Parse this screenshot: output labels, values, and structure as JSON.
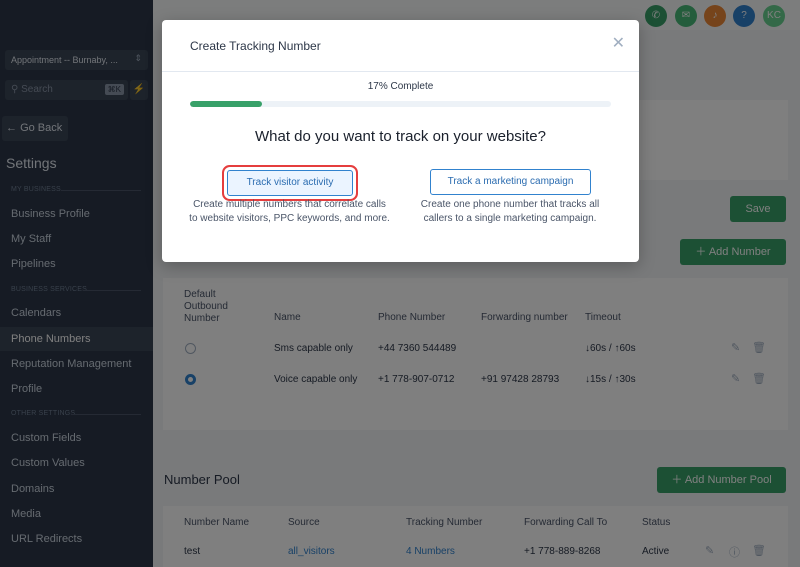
{
  "sidebar": {
    "location": "Appointment -- Burnaby, ...",
    "search_placeholder": "Search",
    "search_shortcut": "⌘K",
    "go_back": "Go Back",
    "title": "Settings",
    "sections": {
      "my_business": "MY BUSINESS",
      "business_services": "BUSINESS SERVICES",
      "other_settings": "OTHER SETTINGS"
    },
    "items": {
      "business_profile": "Business Profile",
      "my_staff": "My Staff",
      "pipelines": "Pipelines",
      "calendars": "Calendars",
      "phone_numbers": "Phone Numbers",
      "reputation_management": "Reputation Management",
      "profile": "Profile",
      "custom_fields": "Custom Fields",
      "custom_values": "Custom Values",
      "domains": "Domains",
      "media": "Media",
      "url_redirects": "URL Redirects"
    }
  },
  "topbar": {
    "avatar_initials": "KC",
    "colors": {
      "phone": "#38a169",
      "megaphone": "#48bb78",
      "bell": "#ed8936",
      "help": "#3182ce",
      "avatar": "#68d391"
    }
  },
  "main": {
    "save_label": "Save",
    "add_number_label": "Add Number",
    "numbers_table": {
      "headers": [
        "Default Outbound Number",
        "Name",
        "Phone Number",
        "Forwarding number",
        "Timeout"
      ],
      "rows": [
        {
          "default": false,
          "name": "Sms capable only",
          "phone": "+44 7360 544489",
          "forwarding": "",
          "timeout_in": "60s",
          "timeout_out": "60s"
        },
        {
          "default": true,
          "name": "Voice capable only",
          "phone": "+1 778-907-0712",
          "forwarding": "+91 97428 28793",
          "timeout_in": "15s",
          "timeout_out": "30s"
        }
      ]
    },
    "number_pool": {
      "title": "Number Pool",
      "add_label": "Add Number Pool",
      "headers": [
        "Number Name",
        "Source",
        "Tracking Number",
        "Forwarding Call To",
        "Status"
      ],
      "rows": [
        {
          "name": "test",
          "source": "all_visitors",
          "tracking": "4 Numbers",
          "forwarding": "+1 778-889-8268",
          "status": "Active"
        }
      ]
    }
  },
  "modal": {
    "title": "Create Tracking Number",
    "progress_label": "17% Complete",
    "progress_fraction": 0.17,
    "question": "What do you want to track on your website?",
    "option_visitor": {
      "label": "Track visitor activity",
      "desc_line1": "Create multiple numbers that correlate calls",
      "desc_line2": "to website visitors, PPC keywords, and more."
    },
    "option_campaign": {
      "label": "Track a marketing campaign",
      "desc_line1": "Create one phone number that tracks all",
      "desc_line2": "callers to a single marketing campaign."
    }
  }
}
